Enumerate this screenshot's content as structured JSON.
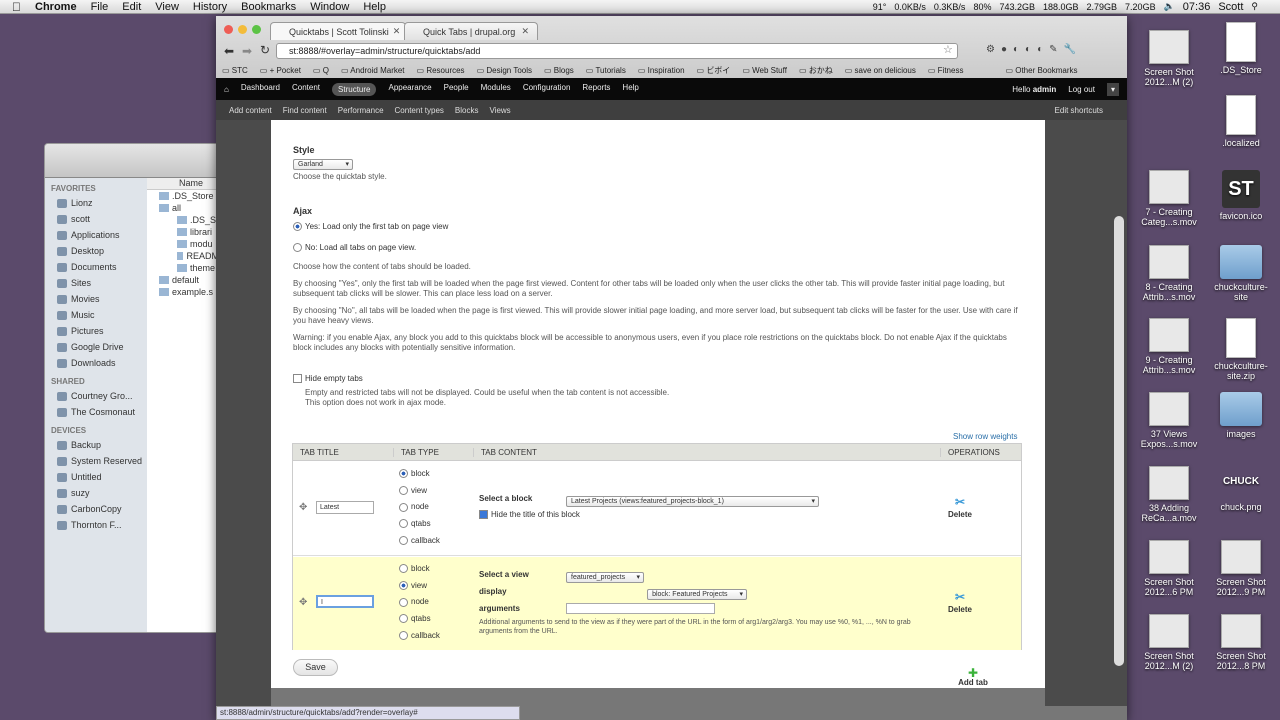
{
  "menubar": {
    "app": "Chrome",
    "items": [
      "File",
      "Edit",
      "View",
      "History",
      "Bookmarks",
      "Window",
      "Help"
    ],
    "temp": "91°",
    "net_up": "0.0KB/s",
    "net_down": "0.3KB/s",
    "battery": "80%",
    "disk1": "743.2GB",
    "disk2": "188.0GB",
    "mem1": "2.79GB",
    "mem2": "7.20GB",
    "clock": "07:36",
    "user": "Scott"
  },
  "desktop": {
    "icons": [
      {
        "label": "Screen Shot 2012...M (2)",
        "kind": "thumb"
      },
      {
        "label": ".DS_Store",
        "kind": "doc"
      },
      {
        "label": ".localized",
        "kind": "doc"
      },
      {
        "label": "7 - Creating Categ...s.mov",
        "kind": "thumb"
      },
      {
        "label": "favicon.ico",
        "kind": "st"
      },
      {
        "label": "8 - Creating Attrib...s.mov",
        "kind": "thumb"
      },
      {
        "label": "chuckculture-site",
        "kind": "folder"
      },
      {
        "label": "9 - Creating Attrib...s.mov",
        "kind": "thumb"
      },
      {
        "label": "chuckculture-site.zip",
        "kind": "doc"
      },
      {
        "label": "37 Views Expos...s.mov",
        "kind": "thumb"
      },
      {
        "label": "images",
        "kind": "folder"
      },
      {
        "label": "38 Adding ReCa...a.mov",
        "kind": "thumb"
      },
      {
        "label": "chuck.png",
        "kind": "chuck"
      },
      {
        "label": "Screen Shot 2012...6 PM",
        "kind": "thumb"
      },
      {
        "label": "Screen Shot 2012...9 PM",
        "kind": "thumb"
      },
      {
        "label": "Screen Shot 2012...M (2)",
        "kind": "thumb"
      },
      {
        "label": "Screen Shot 2012...8 PM",
        "kind": "thumb"
      }
    ],
    "chuck_logo": "CHUCK",
    "st_logo": "ST"
  },
  "finder": {
    "favorites_header": "FAVORITES",
    "favorites": [
      "Lionz",
      "scott",
      "Applications",
      "Desktop",
      "Documents",
      "Sites",
      "Movies",
      "Music",
      "Pictures",
      "Google Drive",
      "Downloads"
    ],
    "shared_header": "SHARED",
    "shared": [
      "Courtney Gro...",
      "The Cosmonaut"
    ],
    "devices_header": "DEVICES",
    "devices": [
      "Backup",
      "System Reserved",
      "Untitled",
      "suzy",
      "CarbonCopy",
      "Thornton F..."
    ],
    "column_name": "Name",
    "rows": [
      ".DS_Store",
      "all",
      ".DS_S",
      "librari",
      "modu",
      "READM",
      "theme",
      "default",
      "example.s"
    ]
  },
  "browser": {
    "tabs": [
      "Quicktabs | Scott Tolinski",
      "Quick Tabs | drupal.org"
    ],
    "url": "st:8888/#overlay=admin/structure/quicktabs/add",
    "bookmarks": [
      "STC",
      "+ Pocket",
      "Q",
      "Android Market",
      "Resources",
      "Design Tools",
      "Blogs",
      "Tutorials",
      "Inspiration",
      "ビボイ",
      "Web Stuff",
      "おかね",
      "save on delicious",
      "Fitness",
      "Other Bookmarks"
    ],
    "status_url": "st:8888/admin/structure/quicktabs/add?render=overlay#"
  },
  "drupal": {
    "toolbar": [
      "Dashboard",
      "Content",
      "Structure",
      "Appearance",
      "People",
      "Modules",
      "Configuration",
      "Reports",
      "Help"
    ],
    "hello": "Hello",
    "username": "admin",
    "logout": "Log out",
    "shortcuts": [
      "Add content",
      "Find content",
      "Performance",
      "Content types",
      "Blocks",
      "Views"
    ],
    "edit_shortcuts": "Edit shortcuts"
  },
  "form": {
    "style_label": "Style",
    "style_value": "Garland",
    "style_desc": "Choose the quicktab style.",
    "ajax_label": "Ajax",
    "ajax_yes": "Yes: Load only the first tab on page view",
    "ajax_no": "No: Load all tabs on page view.",
    "ajax_desc1": "Choose how the content of tabs should be loaded.",
    "ajax_desc2": "By choosing \"Yes\", only the first tab will be loaded when the page first viewed. Content for other tabs will be loaded only when the user clicks the other tab. This will provide faster initial page loading, but subsequent tab clicks will be slower. This can place less load on a server.",
    "ajax_desc3": "By choosing \"No\", all tabs will be loaded when the page is first viewed. This will provide slower initial page loading, and more server load, but subsequent tab clicks will be faster for the user. Use with care if you have heavy views.",
    "ajax_desc4": "Warning: if you enable Ajax, any block you add to this quicktabs block will be accessible to anonymous users, even if you place role restrictions on the quicktabs block. Do not enable Ajax if the quicktabs block includes any blocks with potentially sensitive information.",
    "hide_empty": "Hide empty tabs",
    "hide_empty_desc1": "Empty and restricted tabs will not be displayed. Could be useful when the tab content is not accessible.",
    "hide_empty_desc2": "This option does not work in ajax mode.",
    "show_row_weights": "Show row weights",
    "col_title": "TAB TITLE",
    "col_type": "TAB TYPE",
    "col_content": "TAB CONTENT",
    "col_ops": "OPERATIONS",
    "types": [
      "block",
      "view",
      "node",
      "qtabs",
      "callback"
    ],
    "row1": {
      "title": "Latest",
      "type": "block",
      "select_block_label": "Select a block",
      "block_value": "Latest Projects (views:featured_projects-block_1)",
      "hide_title": "Hide the title of this block"
    },
    "row2": {
      "title": "I",
      "type": "view",
      "select_view_label": "Select a view",
      "view_value": "featured_projects",
      "display_label": "display",
      "display_value": "block: Featured Projects",
      "arguments_label": "arguments",
      "arguments_value": "",
      "arguments_desc": "Additional arguments to send to the view as if they were part of the URL in the form of arg1/arg2/arg3. You may use %0, %1, ..., %N to grab arguments from the URL."
    },
    "delete": "Delete",
    "save": "Save",
    "add_tab": "Add tab"
  }
}
